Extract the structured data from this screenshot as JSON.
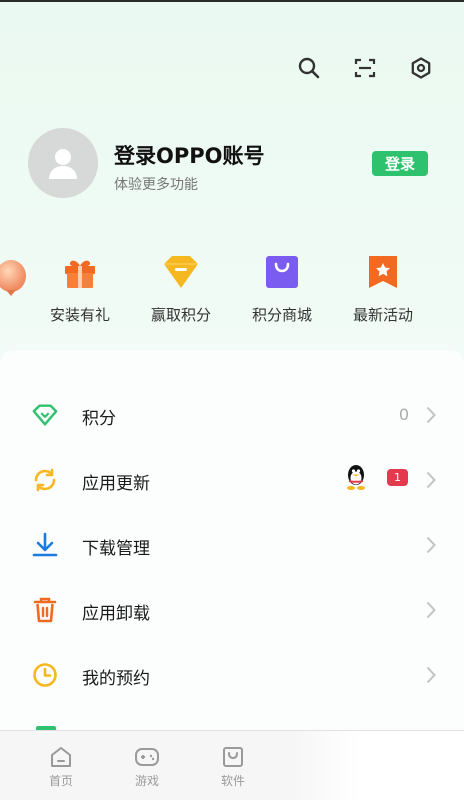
{
  "header": {
    "icons": [
      "search-icon",
      "scan-icon",
      "settings-icon"
    ]
  },
  "profile": {
    "title": "登录OPPO账号",
    "subtitle": "体验更多功能",
    "login_label": "登录"
  },
  "quick_actions": [
    {
      "label": "安装有礼",
      "icon": "gift-icon",
      "color": "#f26a21"
    },
    {
      "label": "赢取积分",
      "icon": "gem-icon",
      "color": "#f6b820"
    },
    {
      "label": "积分商城",
      "icon": "shopping-bag-icon",
      "color": "#7a5cf0"
    },
    {
      "label": "最新活动",
      "icon": "star-bookmark-icon",
      "color": "#f26a21"
    }
  ],
  "menu": [
    {
      "label": "积分",
      "icon": "diamond-icon",
      "value": "0"
    },
    {
      "label": "应用更新",
      "icon": "refresh-icon",
      "badge": "1"
    },
    {
      "label": "下载管理",
      "icon": "download-icon"
    },
    {
      "label": "应用卸载",
      "icon": "trash-icon"
    },
    {
      "label": "我的预约",
      "icon": "clock-icon"
    }
  ],
  "tabbar": [
    {
      "label": "首页",
      "icon": "home-icon"
    },
    {
      "label": "游戏",
      "icon": "gamepad-icon"
    },
    {
      "label": "软件",
      "icon": "app-bag-icon"
    }
  ],
  "colors": {
    "accent_green": "#2ec26f",
    "badge_red": "#e43a4e",
    "orange": "#f26a21",
    "yellow": "#f6b820",
    "purple": "#7a5cf0",
    "blue": "#1a7be0"
  }
}
